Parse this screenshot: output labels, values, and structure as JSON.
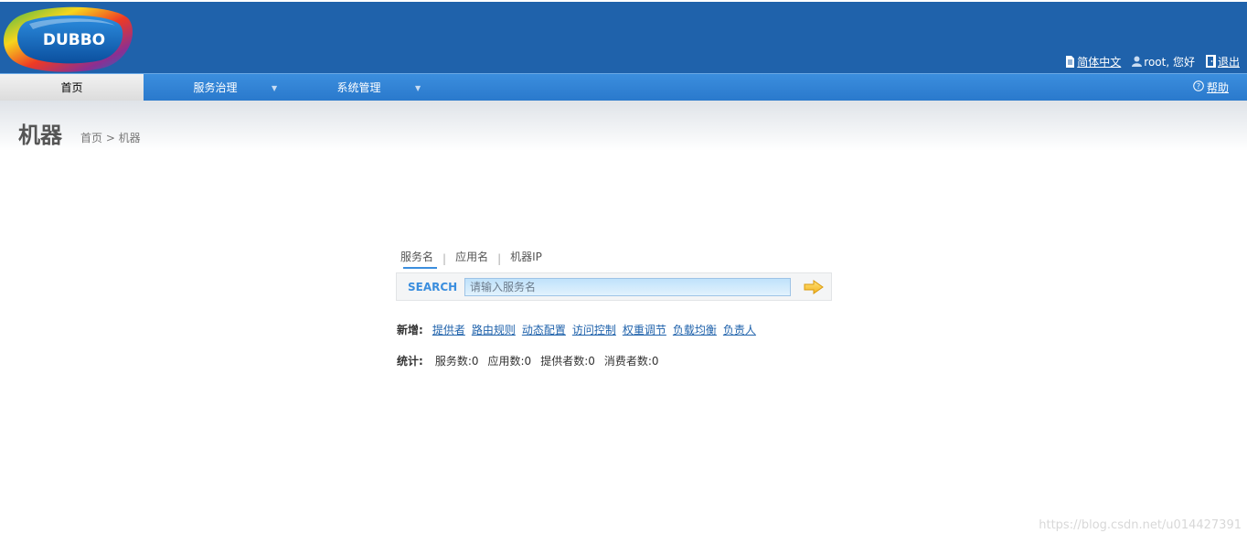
{
  "header": {
    "logo_text": "DUBBO",
    "language_link": "简体中文",
    "user_greeting": "root, 您好",
    "logout_link": "退出"
  },
  "nav": {
    "items": [
      {
        "label": "首页",
        "active": true
      },
      {
        "label": "服务治理",
        "has_dropdown": true
      },
      {
        "label": "系统管理",
        "has_dropdown": true
      }
    ],
    "help_label": "帮助"
  },
  "page": {
    "title": "机器",
    "breadcrumb": "首页 > 机器"
  },
  "search": {
    "tabs": [
      {
        "label": "服务名",
        "active": true
      },
      {
        "label": "应用名"
      },
      {
        "label": "机器IP"
      }
    ],
    "label": "SEARCH",
    "placeholder": "请输入服务名"
  },
  "add_links": {
    "label": "新增:",
    "links": [
      "提供者",
      "路由规则",
      "动态配置",
      "访问控制",
      "权重调节",
      "负载均衡",
      "负责人"
    ]
  },
  "stats": {
    "label": "统计:",
    "items": [
      "服务数:0",
      "应用数:0",
      "提供者数:0",
      "消费者数:0"
    ]
  },
  "watermark": "https://blog.csdn.net/u014427391",
  "colors": {
    "header_bg": "#1f62ab",
    "nav_bg": "#2a79cc",
    "accent": "#3b8ede"
  }
}
